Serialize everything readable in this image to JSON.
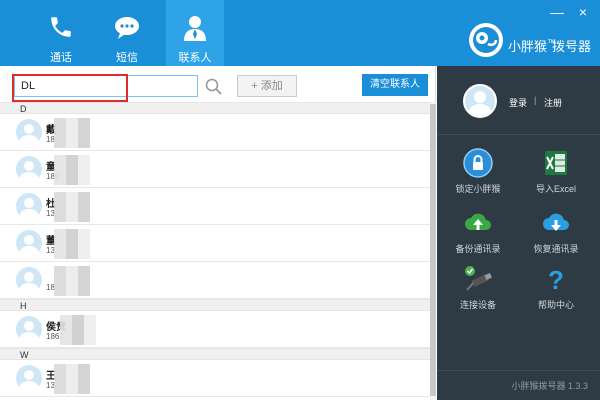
{
  "nav": {
    "items": [
      {
        "label": "通话",
        "icon": "phone-icon"
      },
      {
        "label": "短信",
        "icon": "sms-icon"
      },
      {
        "label": "联系人",
        "icon": "contacts-icon"
      }
    ],
    "active": 2
  },
  "brand": {
    "name": "小胖猴",
    "tm": "™",
    "suffix": "拨号器"
  },
  "window": {
    "minimize": "—",
    "close": "×"
  },
  "search": {
    "value": "DL",
    "placeholder": ""
  },
  "toolbar": {
    "add_label": "+ 添加",
    "clear_label": "清空联系人"
  },
  "groups": [
    {
      "letter": "D",
      "contacts": [
        {
          "name": "戴",
          "phone": "18"
        },
        {
          "name": "童",
          "phone": "189"
        },
        {
          "name": "杜",
          "phone": "13"
        },
        {
          "name": "董",
          "phone": "13"
        },
        {
          "name": "",
          "phone": "18"
        }
      ]
    },
    {
      "letter": "H",
      "contacts": [
        {
          "name": "侯贵",
          "phone": "1867"
        }
      ]
    },
    {
      "letter": "W",
      "contacts": [
        {
          "name": "王",
          "phone": "13"
        }
      ]
    }
  ],
  "account": {
    "login": "登录",
    "separator": "|",
    "register": "注册"
  },
  "tools": [
    {
      "label": "锁定小胖猴",
      "icon": "lock-icon"
    },
    {
      "label": "导入Excel",
      "icon": "excel-icon"
    },
    {
      "label": "备份通讯录",
      "icon": "cloud-upload-icon"
    },
    {
      "label": "恢复通讯录",
      "icon": "cloud-download-icon"
    },
    {
      "label": "连接设备",
      "icon": "usb-connect-icon"
    },
    {
      "label": "帮助中心",
      "icon": "help-icon"
    }
  ],
  "version": "小胖猴拨号器 1.3.3",
  "colors": {
    "header": "#1a8fd8",
    "sidebar": "#2e3a44",
    "highlight": "#e02b2b"
  }
}
